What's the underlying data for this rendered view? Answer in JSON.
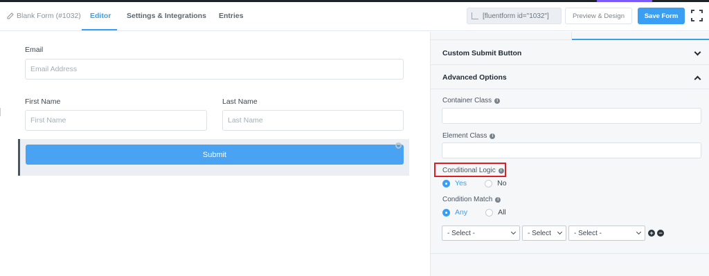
{
  "header": {
    "form_title": "Blank Form (#1032)",
    "tabs": [
      {
        "label": "Editor",
        "active": true
      },
      {
        "label": "Settings & Integrations",
        "active": false
      },
      {
        "label": "Entries",
        "active": false
      }
    ],
    "shortcode": "[fluentform id=\"1032\"]",
    "preview_label": "Preview & Design",
    "save_label": "Save Form",
    "accent_color": "#3a9ff2"
  },
  "form": {
    "email_label": "Email",
    "email_placeholder": "Email Address",
    "first_name_label": "First Name",
    "first_name_placeholder": "First Name",
    "last_name_label": "Last Name",
    "last_name_placeholder": "Last Name",
    "submit_label": "Submit"
  },
  "panel": {
    "custom_submit_title": "Custom Submit Button",
    "advanced_title": "Advanced Options",
    "container_class_label": "Container Class",
    "element_class_label": "Element Class",
    "conditional_logic_label": "Conditional Logic",
    "conditional_options": [
      {
        "label": "Yes",
        "selected": true
      },
      {
        "label": "No",
        "selected": false
      }
    ],
    "condition_match_label": "Condition Match",
    "match_options": [
      {
        "label": "Any",
        "selected": true
      },
      {
        "label": "All",
        "selected": false
      }
    ],
    "selects": [
      "- Select -",
      "- Select",
      "- Select -"
    ],
    "add_symbol": "+",
    "remove_symbol": "−",
    "highlight_color": "#e01b22"
  }
}
